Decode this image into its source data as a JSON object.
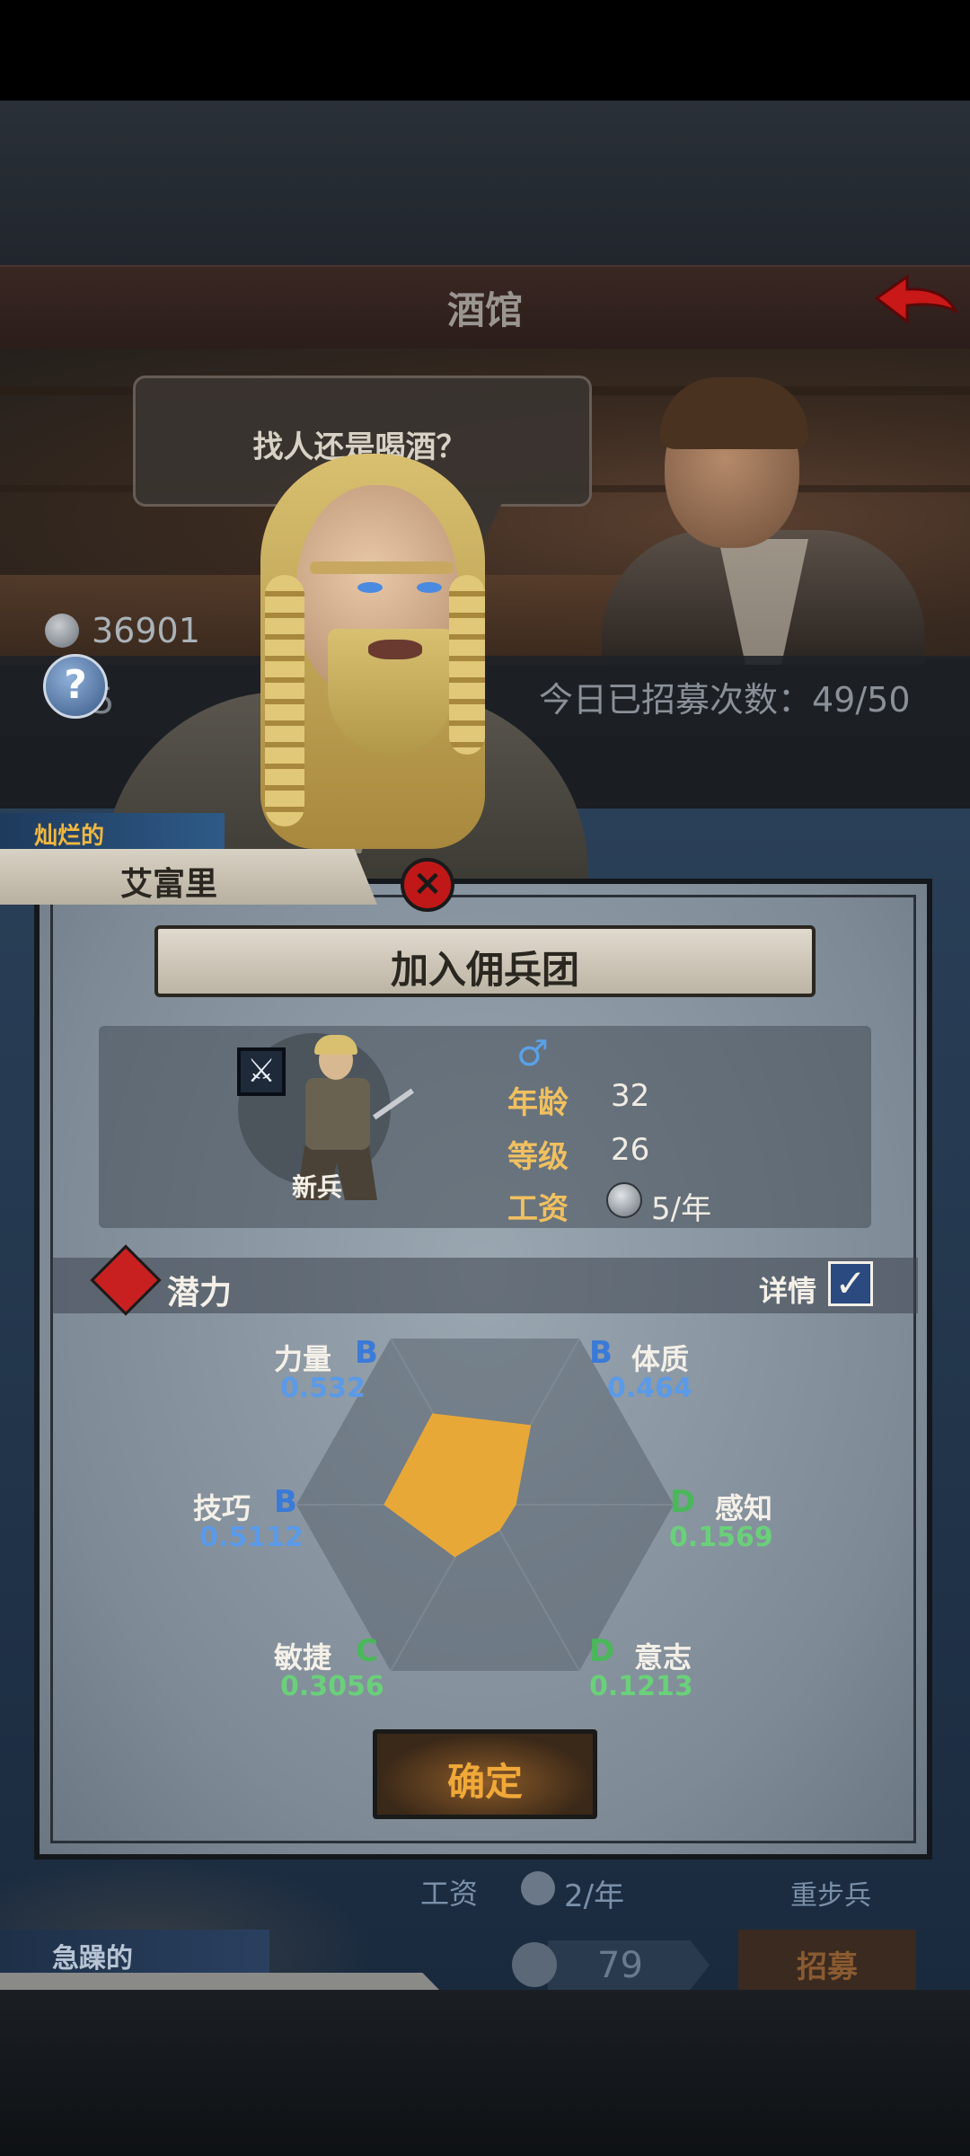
{
  "header": {
    "title": "酒馆"
  },
  "speech": {
    "text": "找人还是喝酒？"
  },
  "resources": {
    "coins": "36901",
    "hidden_number": "5"
  },
  "recruit": {
    "count_text": "今日已招募次数：49/50"
  },
  "hero": {
    "trait": "灿烂的",
    "name": "艾富里"
  },
  "dialog": {
    "title": "加入佣兵团",
    "unit": {
      "rank": "新兵",
      "gender_symbol": "♂",
      "age_label": "年龄",
      "age": "32",
      "level_label": "等级",
      "level": "26",
      "wage_label": "工资",
      "wage": "5/年"
    },
    "potential": {
      "label": "潜力",
      "details_label": "详情",
      "details_checked": true
    },
    "attributes": [
      {
        "name": "力量",
        "grade": "B",
        "value": "0.532"
      },
      {
        "name": "体质",
        "grade": "B",
        "value": "0.464"
      },
      {
        "name": "感知",
        "grade": "D",
        "value": "0.1569"
      },
      {
        "name": "意志",
        "grade": "D",
        "value": "0.1213"
      },
      {
        "name": "敏捷",
        "grade": "C",
        "value": "0.3056"
      },
      {
        "name": "技巧",
        "grade": "B",
        "value": "0.5112"
      }
    ],
    "confirm_label": "确定"
  },
  "background_row": {
    "wage_label": "工资",
    "wage": "2/年",
    "class": "重步兵",
    "trait": "急躁的",
    "price": "79",
    "recruit_label": "招募"
  },
  "colors": {
    "accent_gold": "#f0c060",
    "grade_blue": "#3a7ad8",
    "grade_green": "#4ab85a",
    "radar_fill": "#e8a838"
  },
  "icons": {
    "back": "back-arrow-icon",
    "help": "help-icon",
    "close": "close-icon",
    "class": "sword-icon",
    "gender": "male-icon",
    "potential": "potential-icon",
    "checkbox": "checkbox-icon",
    "coin": "coin-icon"
  }
}
